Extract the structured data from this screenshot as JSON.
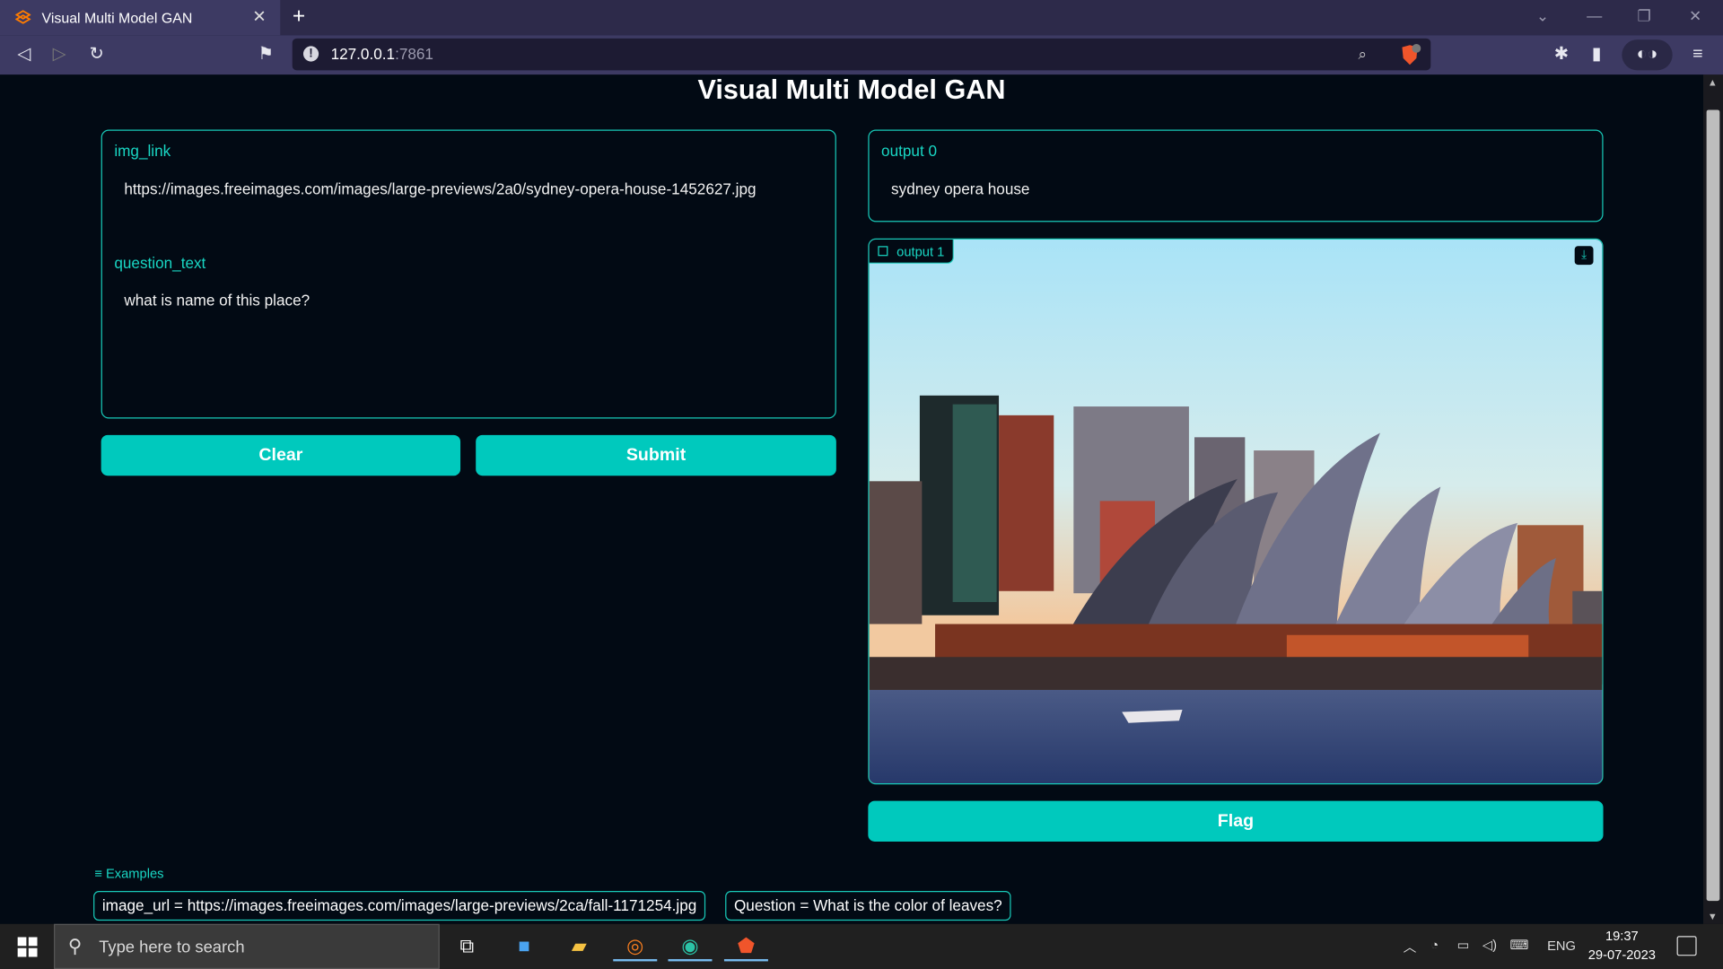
{
  "browser": {
    "tab_title": "Visual Multi Model GAN",
    "url_host": "127.0.0.1",
    "url_port": ":7861"
  },
  "app": {
    "title": "Visual Multi Model GAN",
    "inputs": {
      "img_link_label": "img_link",
      "img_link_value": "https://images.freeimages.com/images/large-previews/2a0/sydney-opera-house-1452627.jpg",
      "question_label": "question_text",
      "question_value": "what is name of this place?"
    },
    "buttons": {
      "clear": "Clear",
      "submit": "Submit",
      "flag": "Flag"
    },
    "outputs": {
      "output0_label": "output 0",
      "output0_value": "sydney opera house",
      "output1_label": "output 1"
    },
    "examples": {
      "header": "Examples",
      "items": [
        "image_url = https://images.freeimages.com/images/large-previews/2ca/fall-1171254.jpg",
        "Question = What is the color of leaves?"
      ]
    }
  },
  "taskbar": {
    "search_placeholder": "Type here to search",
    "language": "ENG",
    "time": "19:37",
    "date": "29-07-2023"
  },
  "colors": {
    "accent": "#00c9bd",
    "background": "#020a14"
  }
}
